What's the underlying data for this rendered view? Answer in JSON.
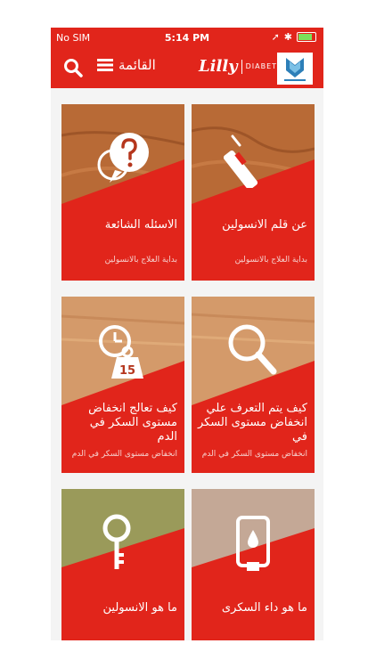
{
  "status": {
    "carrier": "No SIM",
    "time": "5:14 PM"
  },
  "appbar": {
    "menu_label": "القائمة",
    "brand": "Lilly",
    "brand_sub": "DIABETES"
  },
  "tiles": [
    {
      "title": "عن قلم الانسولين",
      "subtitle": "بداية العلاج بالانسولين",
      "icon": "insulin-pen-icon"
    },
    {
      "title": "الاسئله الشائعة",
      "subtitle": "بداية العلاج بالانسولين",
      "icon": "faq-bubble-icon"
    },
    {
      "title": "كيف يتم التعرف علي انخفاض مستوى السكر في",
      "subtitle": "انخفاض مستوى السكر في الدم",
      "icon": "magnifier-icon"
    },
    {
      "title": "كيف تعالج انخفاض مستوى السكر في الدم",
      "subtitle": "انخفاض مستوى السكر في الدم",
      "icon": "clock-weight-icon",
      "badge": "15"
    },
    {
      "title": "ما هو داء السكرى",
      "subtitle": "",
      "icon": "glucose-meter-icon"
    },
    {
      "title": "ما هو الانسولين",
      "subtitle": "",
      "icon": "key-icon"
    }
  ]
}
